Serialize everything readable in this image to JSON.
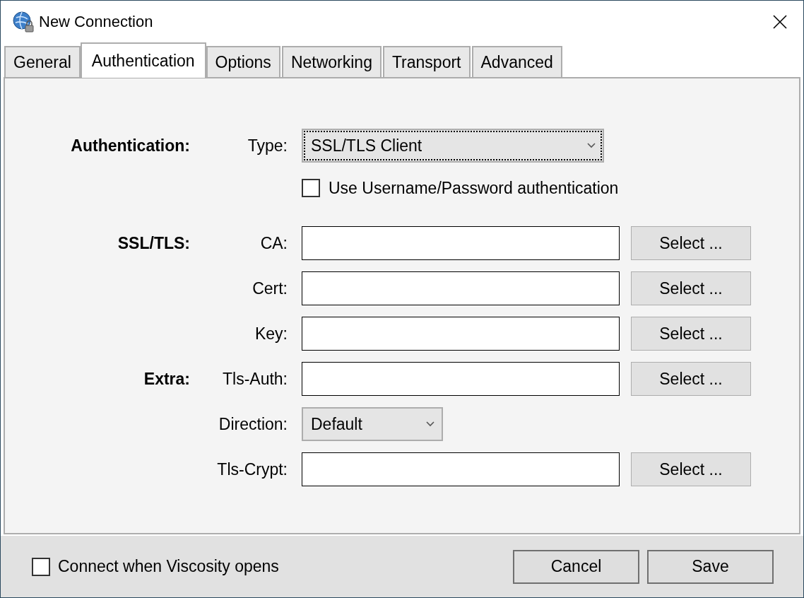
{
  "window": {
    "title": "New Connection"
  },
  "tabs": [
    {
      "label": "General",
      "selected": false
    },
    {
      "label": "Authentication",
      "selected": true
    },
    {
      "label": "Options",
      "selected": false
    },
    {
      "label": "Networking",
      "selected": false
    },
    {
      "label": "Transport",
      "selected": false
    },
    {
      "label": "Advanced",
      "selected": false
    }
  ],
  "authentication": {
    "section_label": "Authentication:",
    "type_label": "Type:",
    "type_value": "SSL/TLS Client",
    "use_password": {
      "label": "Use Username/Password authentication",
      "checked": false
    }
  },
  "rows": [
    {
      "kind": "file",
      "section": "SSL/TLS:",
      "label": "CA:",
      "button": "Select ..."
    },
    {
      "kind": "file",
      "label": "Cert:",
      "button": "Select ..."
    },
    {
      "kind": "file",
      "label": "Key:",
      "button": "Select ..."
    },
    {
      "kind": "file",
      "section": "Extra:",
      "label": "Tls-Auth:",
      "button": "Select ..."
    },
    {
      "kind": "dropdown",
      "label": "Direction:",
      "value": "Default"
    },
    {
      "kind": "file",
      "label": "Tls-Crypt:",
      "button": "Select ..."
    }
  ],
  "footer": {
    "connect_on_open": {
      "label": "Connect when Viscosity opens",
      "checked": false
    },
    "buttons": [
      "Cancel",
      "Save"
    ]
  }
}
